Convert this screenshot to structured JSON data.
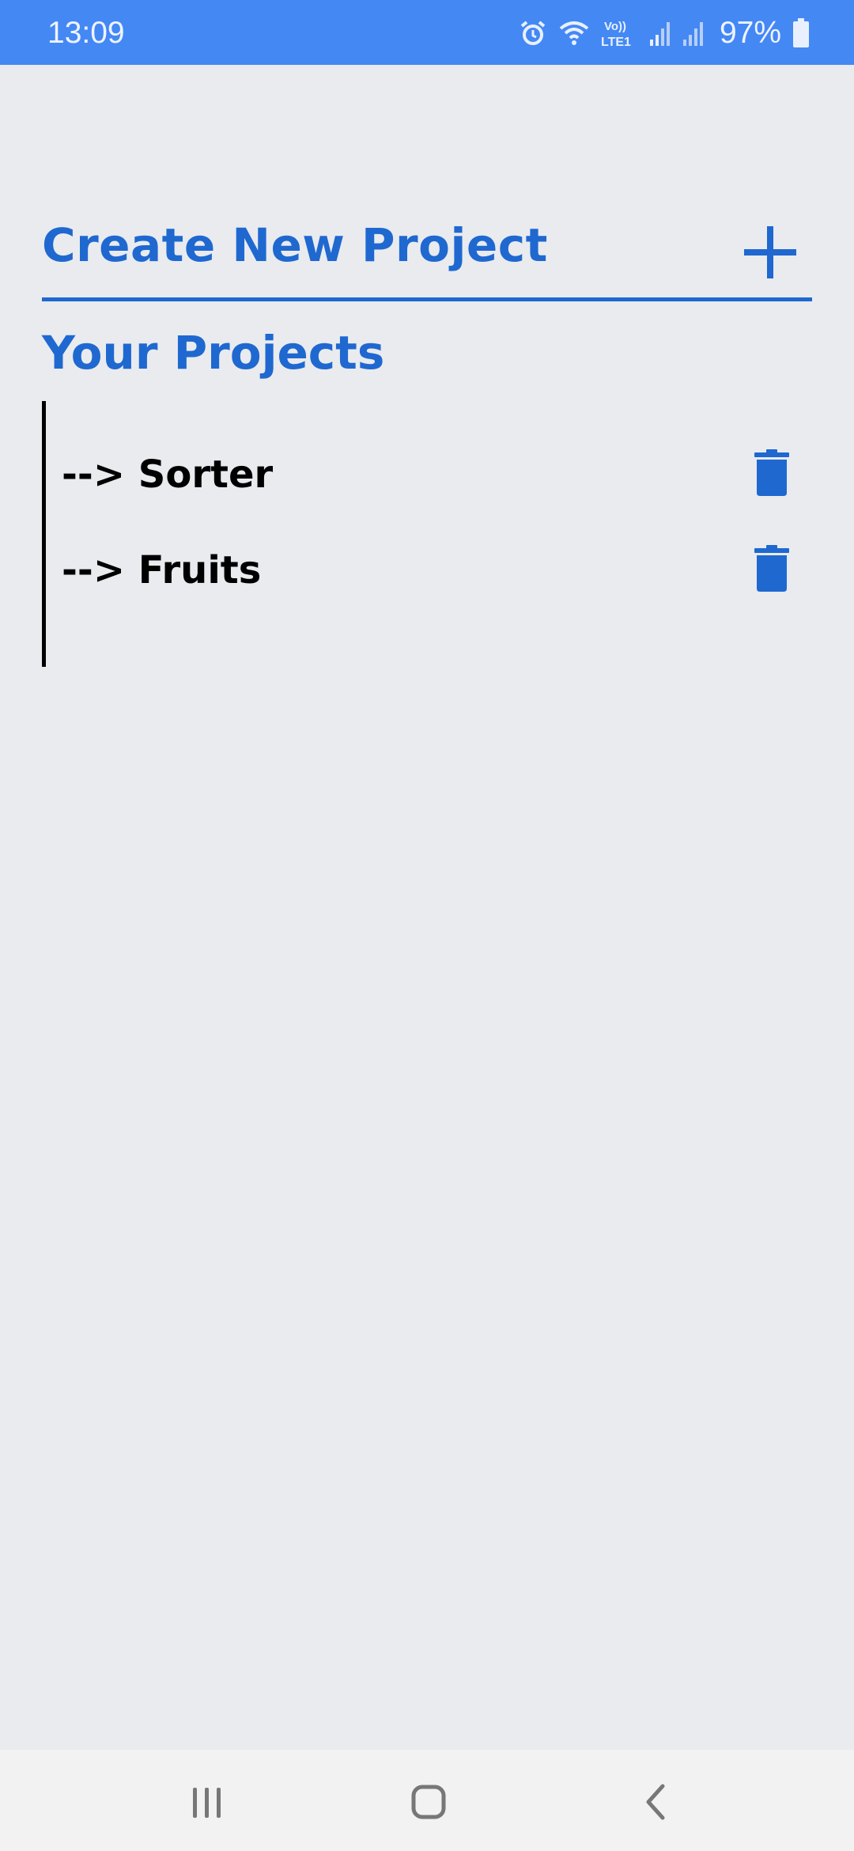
{
  "status_bar": {
    "time": "13:09",
    "network_label_top": "Vo))",
    "network_label_bottom": "LTE1",
    "battery_percent": "97%",
    "icons": [
      "alarm-icon",
      "wifi-icon",
      "volte-icon",
      "signal-icon",
      "signal-icon",
      "battery-icon"
    ]
  },
  "header": {
    "create_label": "Create New Project",
    "add_icon": "plus-icon"
  },
  "projects": {
    "heading": "Your Projects",
    "items": [
      {
        "label": "--> Sorter",
        "delete_icon": "trash-icon"
      },
      {
        "label": "--> Fruits",
        "delete_icon": "trash-icon"
      }
    ]
  },
  "nav_bar": {
    "icons": [
      "recents-icon",
      "home-icon",
      "back-icon"
    ]
  },
  "colors": {
    "accent": "#1f68d0",
    "status_bar": "#4488f4",
    "background": "#e9ebef",
    "nav_bar": "#f2f2f2"
  }
}
